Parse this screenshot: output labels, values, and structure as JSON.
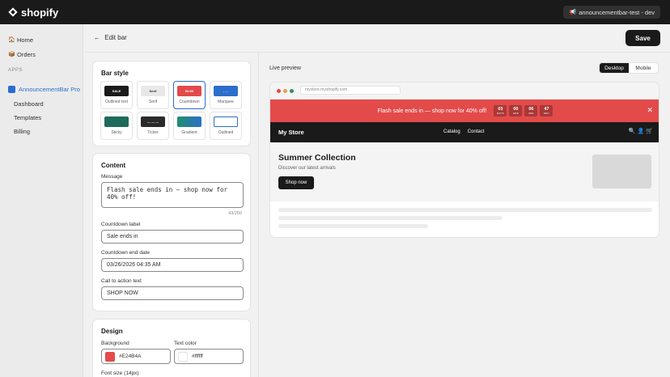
{
  "topbar": {
    "brand": "shopify",
    "store_pill": "announcementbar-test - dev"
  },
  "sidebar": {
    "items": [
      {
        "label": "Home",
        "icon": "home-icon"
      },
      {
        "label": "Orders",
        "icon": "orders-icon"
      }
    ],
    "section_label": "APPS",
    "app": {
      "label": "AnnouncementBar Pro",
      "icon": "app-icon"
    },
    "sub_items": [
      "Dashboard",
      "Templates",
      "Billing"
    ]
  },
  "header": {
    "back_label": "Edit bar",
    "save_label": "Save"
  },
  "bar_style": {
    "title": "Bar style",
    "selected": "Countdown",
    "tiles": [
      {
        "label": "Outlined text",
        "swatch_text": "SALE",
        "swatch_bg": "#1a1a1a",
        "swatch_fg": "#ffffff"
      },
      {
        "label": "Serif",
        "swatch_text": "Serif",
        "swatch_bg": "#e8e8e8",
        "swatch_fg": "#303030"
      },
      {
        "label": "Countdown",
        "swatch_text": "00:00",
        "swatch_bg": "#e24b4a",
        "swatch_fg": "#ffffff"
      },
      {
        "label": "Marquee",
        "swatch_text": "- - -",
        "swatch_bg": "#2c6ecb",
        "swatch_fg": "#ffffff"
      },
      {
        "label": "Sticky",
        "swatch_text": "",
        "swatch_bg": "#1f6b5a",
        "swatch_fg": "#ffffff"
      },
      {
        "label": "Ticker",
        "swatch_text": "— — —",
        "swatch_bg": "#2a2a2a",
        "swatch_fg": "#ffffff"
      },
      {
        "label": "Gradient",
        "swatch_text": "",
        "swatch_bg": "#2c6ecb",
        "swatch_fg": "#ffffff"
      },
      {
        "label": "Outlined",
        "swatch_text": "",
        "swatch_bg": "#ffffff",
        "swatch_fg": "#2c6ecb"
      }
    ]
  },
  "content": {
    "title": "Content",
    "message_label": "Message",
    "message_value": "Flash sale ends in — shop now for 40% off!",
    "char_count": "43/250",
    "countdown_label_label": "Countdown label",
    "countdown_label_value": "Sale ends in",
    "end_date_label": "Countdown end date",
    "end_date_value": "03/26/2026 04:35 AM",
    "cta_label": "Call to action text",
    "cta_value": "SHOP NOW"
  },
  "design": {
    "title": "Design",
    "background_label": "Background",
    "background_value": "#E24B4A",
    "text_color_label": "Text color",
    "text_color_value": "#ffffff",
    "font_size_label": "Font size (14px)"
  },
  "preview": {
    "label": "Live preview",
    "devices": [
      "Desktop",
      "Mobile"
    ],
    "active_device": "Desktop",
    "url": "mystore.myshopify.com",
    "bar_message": "Flash sale ends in — shop now for 40% off!",
    "countdown": [
      {
        "num": "03",
        "unit": "DAYS"
      },
      {
        "num": "00",
        "unit": "HRS"
      },
      {
        "num": "06",
        "unit": "MIN"
      },
      {
        "num": "47",
        "unit": "SEC"
      }
    ],
    "store_name": "My Store",
    "store_links": [
      "Catalog",
      "Contact"
    ],
    "hero_title": "Summer Collection",
    "hero_subtitle": "Discover our latest arrivals",
    "hero_button": "Shop now"
  },
  "colors": {
    "bar_red": "#e24b4a",
    "accent_blue": "#2c6ecb",
    "dark": "#1a1a1a"
  }
}
